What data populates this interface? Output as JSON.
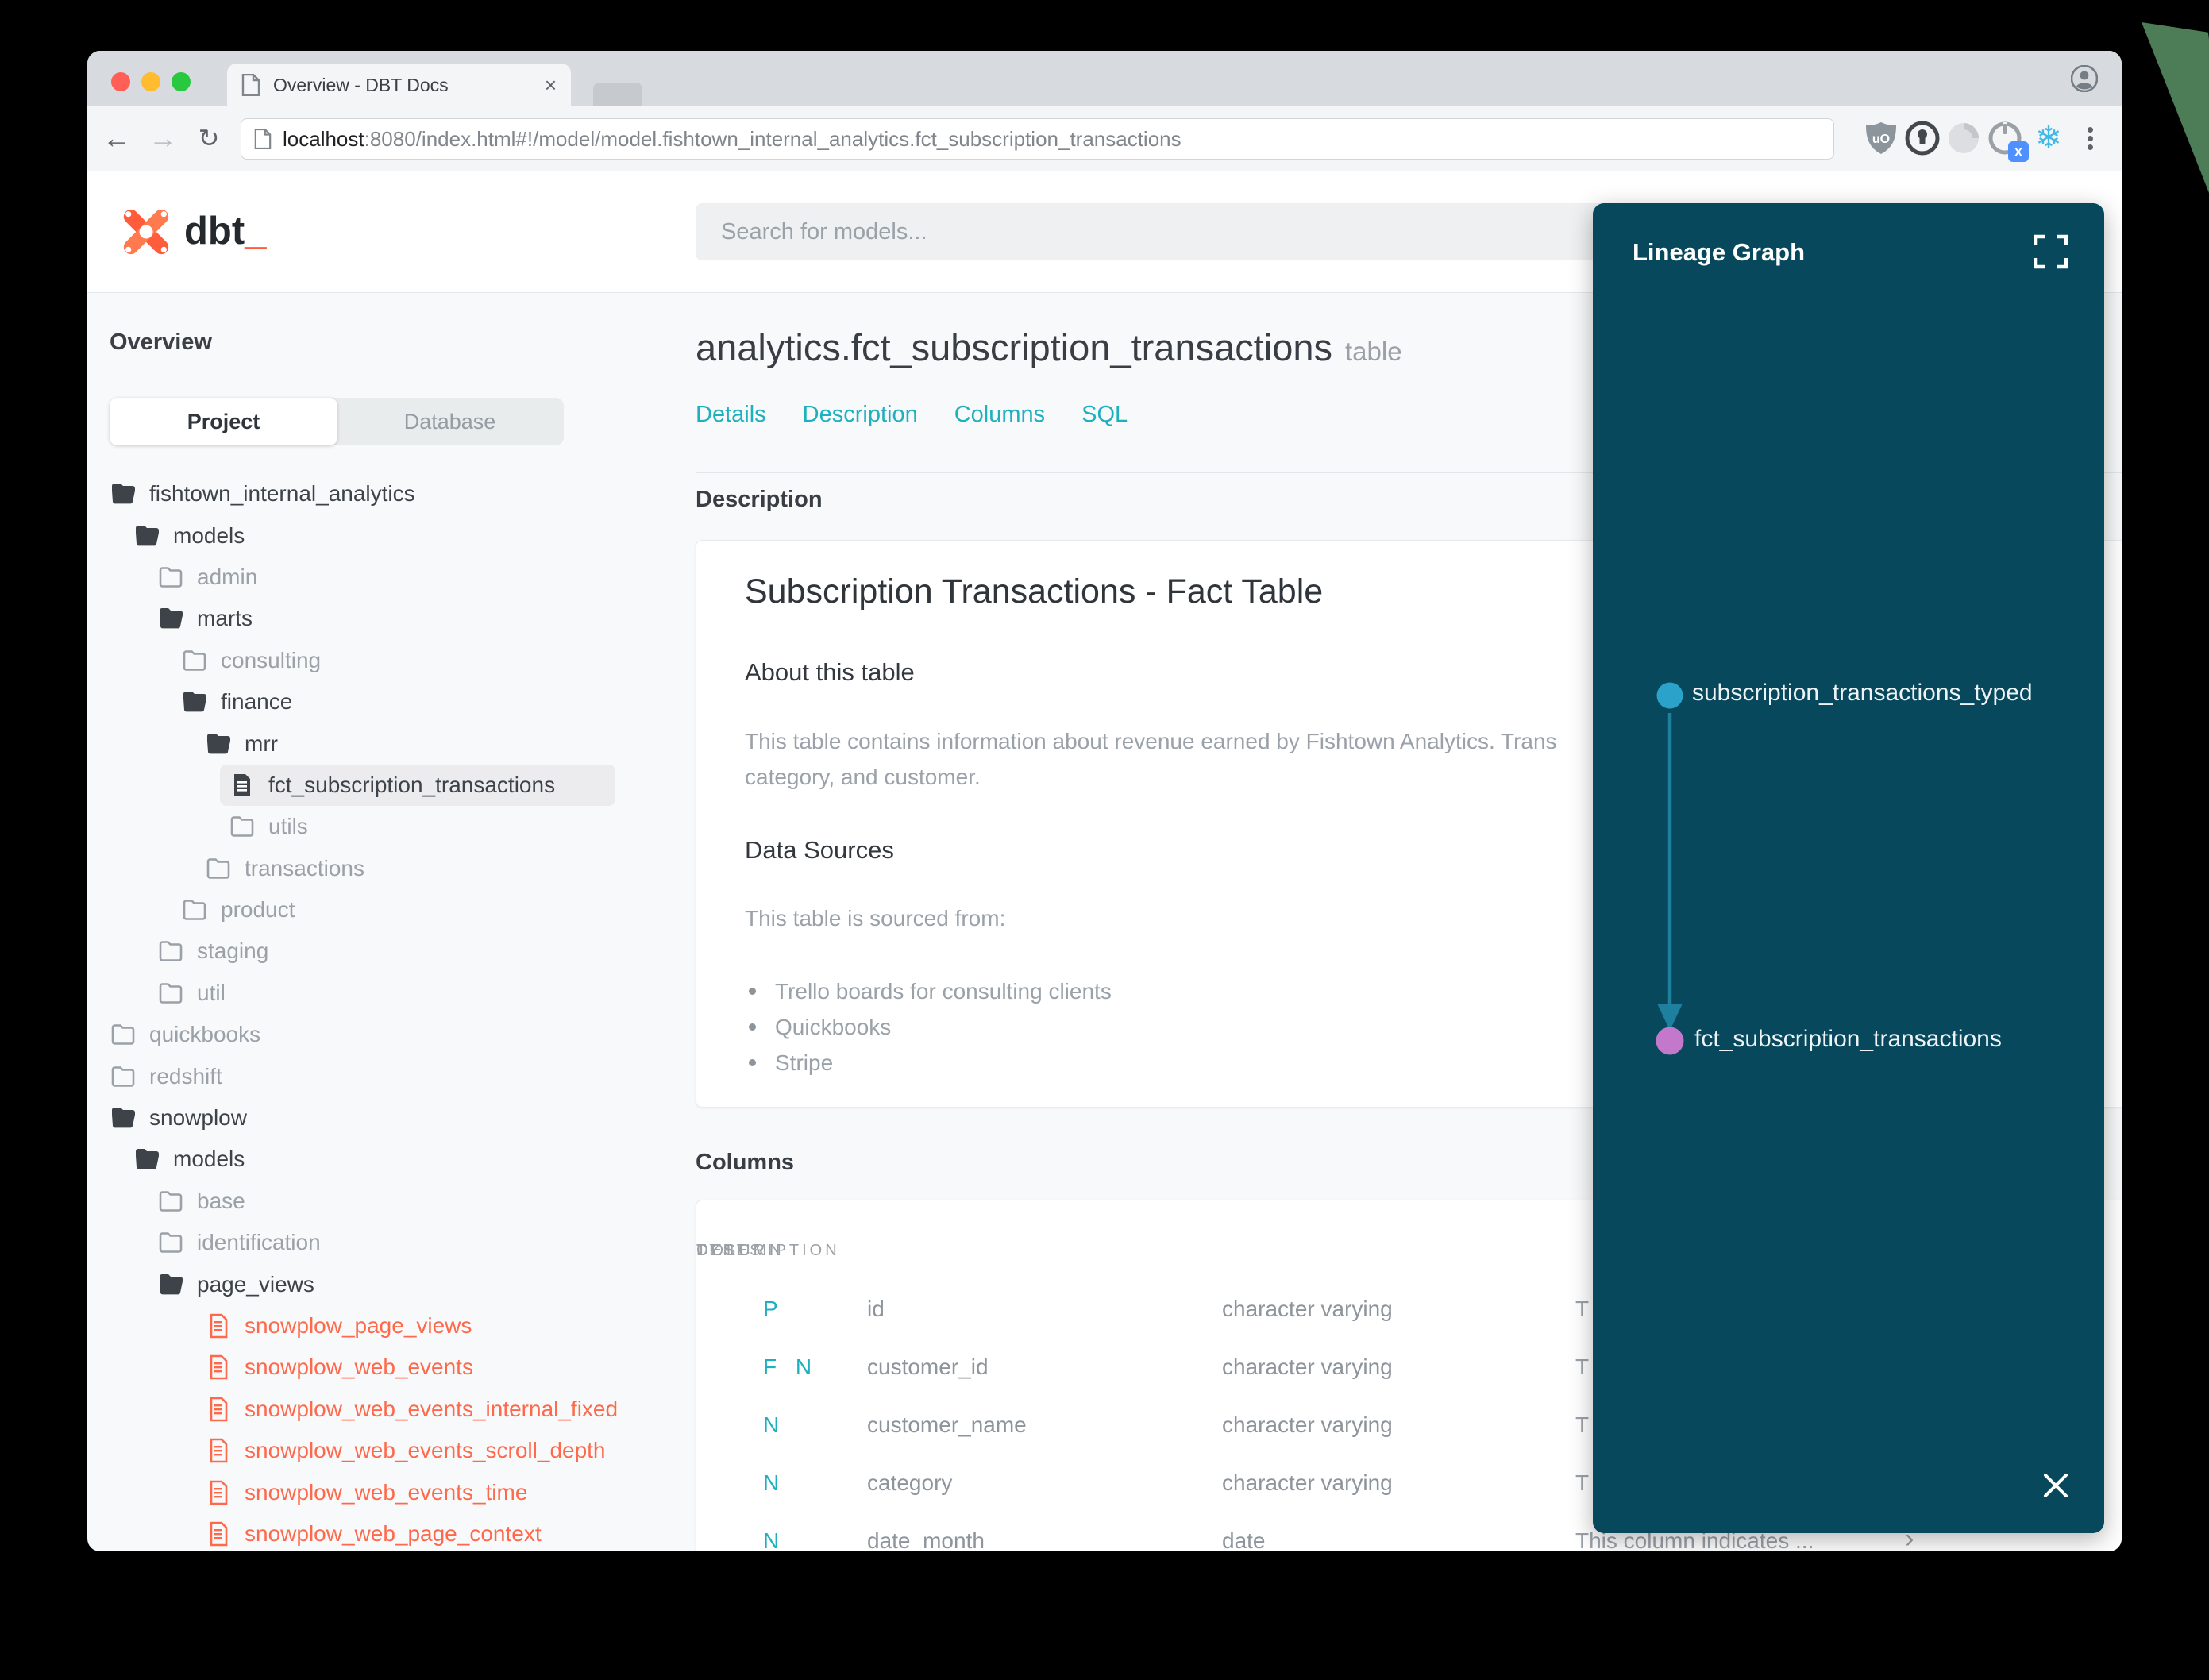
{
  "colors": {
    "accent_teal": "#1db0bf",
    "accent_red": "#ff694b",
    "panel_bg": "#07485c",
    "node_blue": "#2aa2c9",
    "node_purple": "#c478cb",
    "arrow": "#1e7f9e"
  },
  "browser": {
    "tab_title": "Overview - DBT Docs",
    "tab_close": "×",
    "back_icon": "←",
    "forward_icon": "→",
    "reload_icon": "↻",
    "url_host": "localhost",
    "url_rest": ":8080/index.html#!/model/model.fishtown_internal_analytics.fct_subscription_transactions",
    "extensions": [
      "ublock-shield-icon",
      "onepassword-icon",
      "swirl-icon",
      "power-x-icon",
      "snowflake-icon"
    ],
    "snowflake_glyph": "❄",
    "power_badge": "x",
    "ublock_label": "uO"
  },
  "header": {
    "logo_text": "dbt",
    "logo_underscore": "_",
    "search_placeholder": "Search for models..."
  },
  "sidebar": {
    "section_title": "Overview",
    "tabs": {
      "project": "Project",
      "database": "Database"
    },
    "tree": [
      {
        "label": "fishtown_internal_analytics",
        "level": 0,
        "type": "folder-open"
      },
      {
        "label": "models",
        "level": 1,
        "type": "folder-open"
      },
      {
        "label": "admin",
        "level": 2,
        "type": "folder-closed"
      },
      {
        "label": "marts",
        "level": 2,
        "type": "folder-open"
      },
      {
        "label": "consulting",
        "level": 3,
        "type": "folder-closed"
      },
      {
        "label": "finance",
        "level": 3,
        "type": "folder-open"
      },
      {
        "label": "mrr",
        "level": 4,
        "type": "folder-open"
      },
      {
        "label": "fct_subscription_transactions",
        "level": 5,
        "type": "file",
        "selected": "true"
      },
      {
        "label": "utils",
        "level": 5,
        "type": "folder-closed"
      },
      {
        "label": "transactions",
        "level": 4,
        "type": "folder-closed"
      },
      {
        "label": "product",
        "level": 3,
        "type": "folder-closed"
      },
      {
        "label": "staging",
        "level": 2,
        "type": "folder-closed"
      },
      {
        "label": "util",
        "level": 2,
        "type": "folder-closed"
      },
      {
        "label": "quickbooks",
        "level": 0,
        "type": "folder-closed"
      },
      {
        "label": "redshift",
        "level": 0,
        "type": "folder-closed"
      },
      {
        "label": "snowplow",
        "level": 0,
        "type": "folder-open"
      },
      {
        "label": "models",
        "level": 1,
        "type": "folder-open"
      },
      {
        "label": "base",
        "level": 2,
        "type": "folder-closed"
      },
      {
        "label": "identification",
        "level": 2,
        "type": "folder-closed"
      },
      {
        "label": "page_views",
        "level": 2,
        "type": "folder-open"
      },
      {
        "label": "snowplow_page_views",
        "level": 4,
        "type": "file-red"
      },
      {
        "label": "snowplow_web_events",
        "level": 4,
        "type": "file-red"
      },
      {
        "label": "snowplow_web_events_internal_fixed",
        "level": 4,
        "type": "file-red"
      },
      {
        "label": "snowplow_web_events_scroll_depth",
        "level": 4,
        "type": "file-red"
      },
      {
        "label": "snowplow_web_events_time",
        "level": 4,
        "type": "file-red"
      },
      {
        "label": "snowplow_web_page_context",
        "level": 4,
        "type": "file-red"
      }
    ]
  },
  "main": {
    "title": "analytics.fct_subscription_transactions",
    "title_suffix": "table",
    "tabs": [
      "Details",
      "Description",
      "Columns",
      "SQL"
    ],
    "description_heading": "Description",
    "card": {
      "title": "Subscription Transactions - Fact Table",
      "about_heading": "About this table",
      "about_line1": "This table contains information about revenue earned by Fishtown Analytics. Trans",
      "about_line2": "category, and customer.",
      "sources_heading": "Data Sources",
      "sources_intro": "This table is sourced from:",
      "sources": [
        {
          "label": "Trello boards for consulting clients"
        },
        {
          "label": "Quickbooks"
        },
        {
          "label": "Stripe"
        }
      ]
    },
    "columns_heading": "Columns",
    "table": {
      "headers": [
        {
          "label": "TESTS"
        },
        {
          "label": "COLUMN"
        },
        {
          "label": "TYPE"
        },
        {
          "label": "DESCRIPTION"
        }
      ],
      "chevron": "›",
      "rows": [
        {
          "tests": "P",
          "column": "id",
          "type": "character varying",
          "description": "T"
        },
        {
          "tests": "F N",
          "column": "customer_id",
          "type": "character varying",
          "description": "T"
        },
        {
          "tests": "N",
          "column": "customer_name",
          "type": "character varying",
          "description": "T"
        },
        {
          "tests": "N",
          "column": "category",
          "type": "character varying",
          "description": "T"
        },
        {
          "tests": "N",
          "column": "date_month",
          "type": "date",
          "description": "This column indicates ..."
        }
      ]
    }
  },
  "lineage": {
    "title": "Lineage Graph",
    "nodes": [
      {
        "label": "subscription_transactions_typed",
        "color": "#2aa2c9"
      },
      {
        "label": "fct_subscription_transactions",
        "color": "#c478cb"
      }
    ],
    "arrow_color": "#1e7f9e"
  }
}
